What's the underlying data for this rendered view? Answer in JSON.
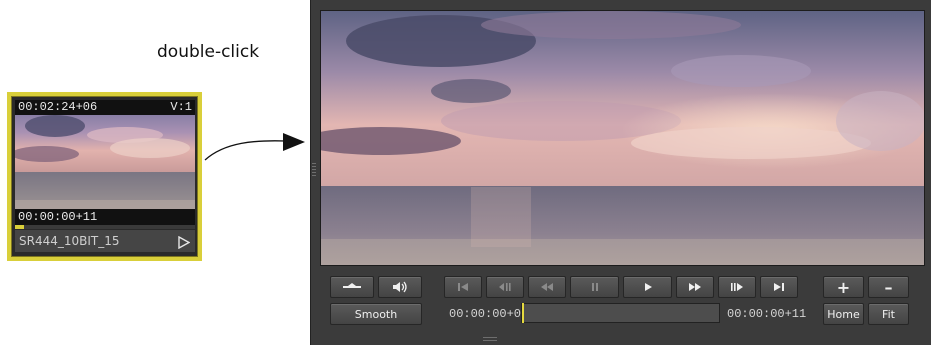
{
  "caption": "double-click",
  "clip": {
    "timecode_top": "00:02:24+06",
    "track": "V:1",
    "timecode_bottom": "00:00:00+11",
    "name": "SR444_10BIT_15",
    "progress": 0.05,
    "border_color": "#d9cf3a"
  },
  "viewer": {
    "transport": {
      "buttons": [
        {
          "name": "goto-start-button",
          "icon": "skip-to-start-icon"
        },
        {
          "name": "step-back-button",
          "icon": "step-back-icon"
        },
        {
          "name": "rewind-button",
          "icon": "rewind-icon"
        },
        {
          "name": "pause-button",
          "icon": "pause-icon"
        },
        {
          "name": "play-button",
          "icon": "play-icon"
        },
        {
          "name": "fast-forward-button",
          "icon": "fast-forward-icon"
        },
        {
          "name": "step-forward-button",
          "icon": "step-forward-icon"
        },
        {
          "name": "goto-end-button",
          "icon": "skip-to-end-icon"
        }
      ]
    },
    "smooth_label": "Smooth",
    "timecode_start": "00:00:00+00",
    "timecode_end": "00:00:00+11",
    "scrub_position": 0.0,
    "zoom_in_label": "+",
    "zoom_out_label": "–",
    "home_label": "Home",
    "fit_label": "Fit",
    "accent_color": "#e5d93f"
  }
}
